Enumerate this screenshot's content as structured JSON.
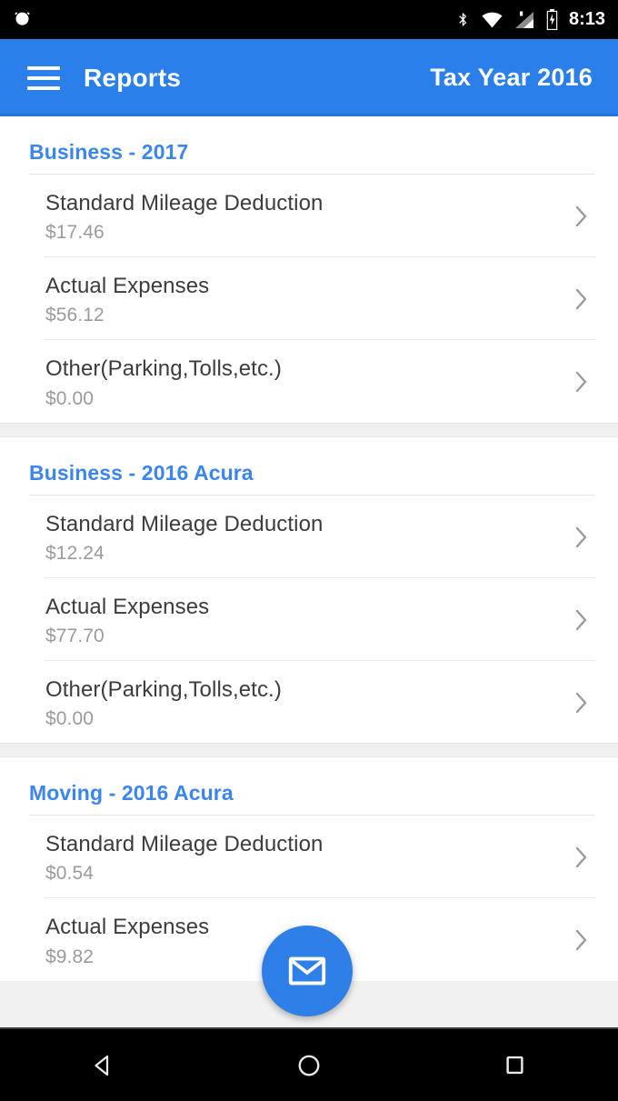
{
  "status_bar": {
    "time": "8:13",
    "icons": [
      "alarm-icon",
      "bluetooth-icon",
      "wifi-icon",
      "cellular-signal-icon",
      "battery-icon"
    ]
  },
  "app_bar": {
    "menu_icon": "hamburger-menu-icon",
    "title": "Reports",
    "action_label": "Tax Year 2016",
    "background_color": "#2a7fea"
  },
  "colors": {
    "accent": "#2a7fea",
    "section_header": "#3b85ee",
    "row_title": "#3c3c3c",
    "row_amount": "#9b9b9b",
    "divider": "#ececec"
  },
  "sections": [
    {
      "header": "Business - 2017",
      "rows": [
        {
          "title": "Standard Mileage Deduction",
          "amount": "$17.46"
        },
        {
          "title": "Actual Expenses",
          "amount": "$56.12"
        },
        {
          "title": "Other(Parking,Tolls,etc.)",
          "amount": "$0.00"
        }
      ]
    },
    {
      "header": "Business - 2016 Acura",
      "rows": [
        {
          "title": "Standard Mileage Deduction",
          "amount": "$12.24"
        },
        {
          "title": "Actual Expenses",
          "amount": "$77.70"
        },
        {
          "title": "Other(Parking,Tolls,etc.)",
          "amount": "$0.00"
        }
      ]
    },
    {
      "header": "Moving - 2016 Acura",
      "rows": [
        {
          "title": "Standard Mileage Deduction",
          "amount": "$0.54"
        },
        {
          "title": "Actual Expenses",
          "amount": "$9.82"
        }
      ]
    }
  ],
  "fab": {
    "icon": "email-envelope-icon",
    "color": "#2f7fe8"
  },
  "nav_bar": {
    "back": "back-triangle-icon",
    "home": "home-circle-icon",
    "recents": "recents-square-icon"
  }
}
